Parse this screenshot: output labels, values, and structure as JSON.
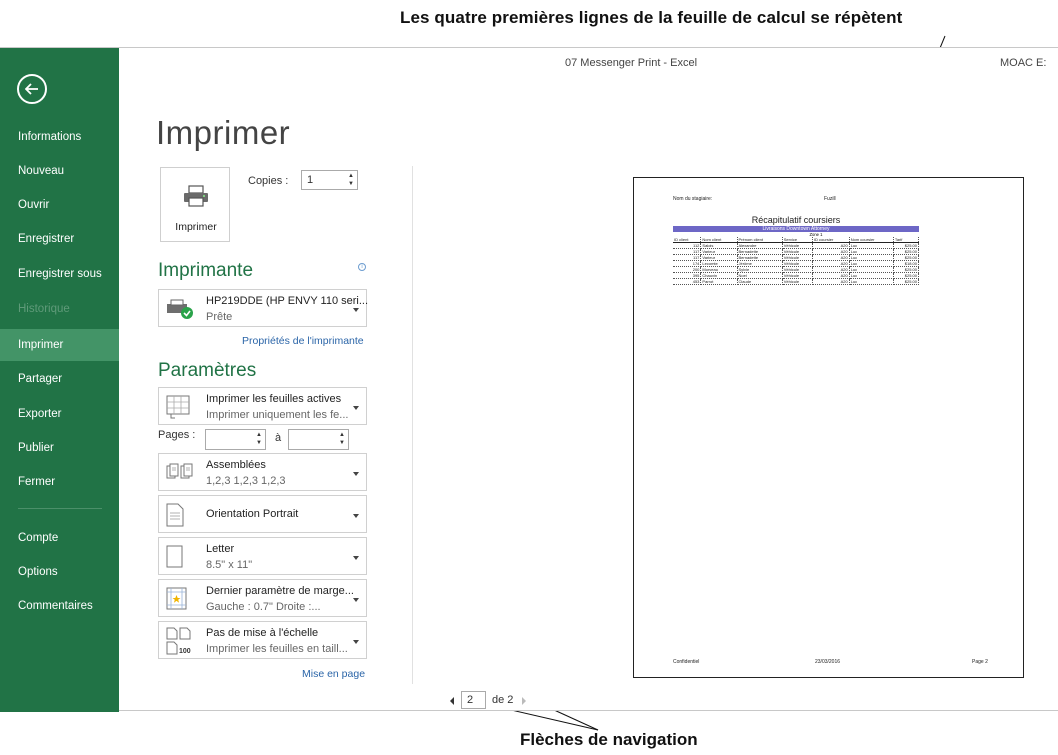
{
  "callouts": {
    "top": "Les quatre premières lignes de la feuille de calcul se répètent",
    "bottom": "Flèches de navigation"
  },
  "window": {
    "title": "07 Messenger Print - Excel",
    "account": "MOAC E:"
  },
  "sidebar": {
    "back_icon": "arrow-left-circle-icon",
    "items": [
      {
        "label": "Informations"
      },
      {
        "label": "Nouveau"
      },
      {
        "label": "Ouvrir"
      },
      {
        "label": "Enregistrer"
      },
      {
        "label": "Enregistrer sous"
      },
      {
        "label": "Historique"
      },
      {
        "label": "Imprimer"
      },
      {
        "label": "Partager"
      },
      {
        "label": "Exporter"
      },
      {
        "label": "Publier"
      },
      {
        "label": "Fermer"
      },
      {
        "label": "Compte"
      },
      {
        "label": "Options"
      },
      {
        "label": "Commentaires"
      }
    ],
    "active": "Imprimer",
    "disabled": "Historique",
    "colors": {
      "background": "#217346",
      "active": "#439467"
    }
  },
  "print": {
    "title": "Imprimer",
    "button_label": "Imprimer",
    "copies_label": "Copies :",
    "copies_value": "1"
  },
  "printer": {
    "section_title": "Imprimante",
    "name": "HP219DDE (HP ENVY 110 seri...",
    "status": "Prête",
    "properties_link": "Propriétés de l'imprimante"
  },
  "settings": {
    "section_title": "Paramètres",
    "active_sheets": {
      "title": "Imprimer les feuilles actives",
      "subtitle": "Imprimer uniquement les fe..."
    },
    "pages_label": "Pages :",
    "pages_to": "à",
    "collated": {
      "title": "Assemblées",
      "subtitle": "1,2,3   1,2,3   1,2,3"
    },
    "orientation": {
      "title": "Orientation Portrait"
    },
    "paper": {
      "title": "Letter",
      "subtitle": "8.5\" x 11\""
    },
    "margins": {
      "title": "Dernier paramètre de marge...",
      "subtitle": "Gauche : 0.7\"       Droite :..."
    },
    "scaling": {
      "title": "Pas de mise à l'échelle",
      "subtitle": "Imprimer les feuilles en taill...",
      "icon_text": "100"
    },
    "page_setup_link": "Mise en page"
  },
  "preview": {
    "header_left": "Nom du stagiaire:",
    "header_right": "Fuzill",
    "sheet_title": "Récapitulatif coursiers",
    "sheet_subtitle": "Livraisons Downtown Attorney",
    "zone_label": "Zone 1",
    "columns": [
      "ID client",
      "Nom client",
      "Prénom client",
      "Service",
      "ID coursier",
      "Nom coursier",
      "Tarif"
    ],
    "rows": [
      [
        "112",
        "Salois",
        "Alexandre",
        "Véhicule",
        "A20",
        "Luc",
        "$25.00"
      ],
      [
        "117",
        "Varieur",
        "Bernadette",
        "Véhicule",
        "A20",
        "Luc",
        "$25.00"
      ],
      [
        "117",
        "Varieur",
        "Bernadette",
        "Véhicule",
        "A20",
        "Luc",
        "$25.00"
      ],
      [
        "174",
        "Lecomte",
        "Jérôme",
        "Véhicule",
        "A20",
        "Luc",
        "$18.00"
      ],
      [
        "200",
        "Morveau",
        "Sylvie",
        "Véhicule",
        "A20",
        "Luc",
        "$25.00"
      ],
      [
        "395",
        "Chauvin",
        "Noel",
        "Véhicule",
        "A20",
        "Luc",
        "$25.00"
      ],
      [
        "453",
        "Parrot",
        "Claude",
        "Véhicule",
        "A20",
        "Luc",
        "$25.00"
      ]
    ],
    "footer_left": "Confidentiel",
    "footer_center": "23/03/2016",
    "footer_right": "Page 2",
    "accent": "#6d67c6"
  },
  "navigation": {
    "current_page": "2",
    "of_label": "de 2"
  }
}
